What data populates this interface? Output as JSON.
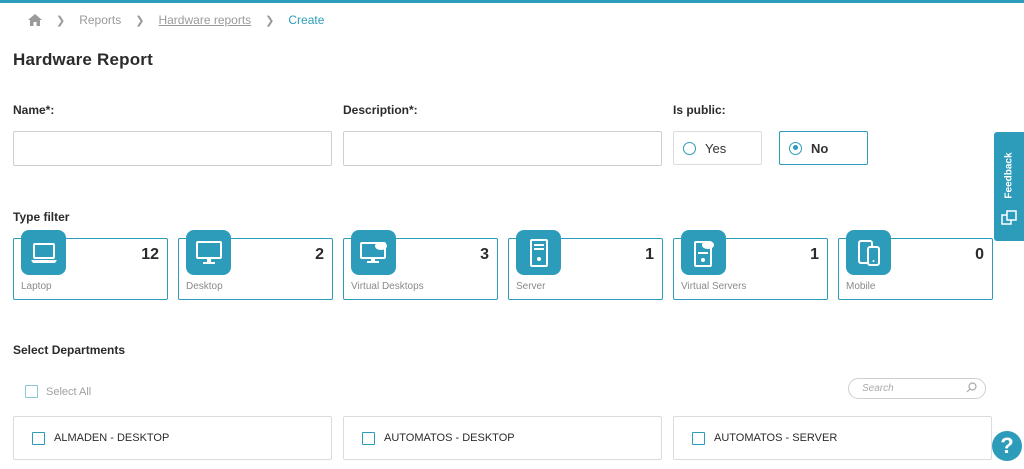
{
  "breadcrumb": {
    "home_icon": "home-icon",
    "items": [
      "Reports",
      "Hardware reports",
      "Create"
    ]
  },
  "page": {
    "title": "Hardware Report"
  },
  "form": {
    "name_label": "Name*:",
    "name_value": "",
    "description_label": "Description*:",
    "description_value": "",
    "public_label": "Is public:",
    "public_options": [
      "Yes",
      "No"
    ],
    "public_selected": "No"
  },
  "type_filter": {
    "title": "Type filter",
    "cards": [
      {
        "label": "Laptop",
        "count": "12",
        "icon": "laptop-icon"
      },
      {
        "label": "Desktop",
        "count": "2",
        "icon": "desktop-icon"
      },
      {
        "label": "Virtual Desktops",
        "count": "3",
        "icon": "virtual-desktop-icon"
      },
      {
        "label": "Server",
        "count": "1",
        "icon": "server-icon"
      },
      {
        "label": "Virtual Servers",
        "count": "1",
        "icon": "virtual-server-icon"
      },
      {
        "label": "Mobile",
        "count": "0",
        "icon": "mobile-icon"
      }
    ]
  },
  "departments": {
    "title": "Select Departments",
    "select_all": "Select All",
    "search_placeholder": "Search",
    "items": [
      "ALMADEN - DESKTOP",
      "AUTOMATOS - DESKTOP",
      "AUTOMATOS - SERVER"
    ]
  },
  "feedback": {
    "label": "Feedback"
  },
  "help": {
    "label": "?"
  },
  "colors": {
    "accent": "#2d9cba",
    "text": "#2b2b2b",
    "muted": "#9a9a9a",
    "border": "#cfcfcf"
  }
}
